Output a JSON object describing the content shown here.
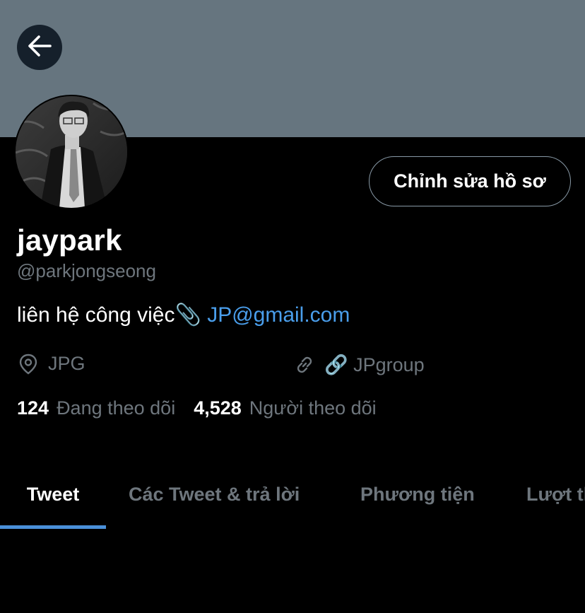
{
  "profile": {
    "display_name": "jaypark",
    "handle": "@parkjongseong",
    "bio_text": "liên hệ công việc📎",
    "bio_link": "JP@gmail.com",
    "location": "JPG",
    "website": "🔗 JPgroup",
    "following_count": "124",
    "following_label": "Đang theo dõi",
    "followers_count": "4,528",
    "followers_label": "Người theo dõi"
  },
  "buttons": {
    "edit_profile": "Chỉnh sửa hồ sơ"
  },
  "tabs": [
    {
      "label": "Tweet",
      "active": true
    },
    {
      "label": "Các Tweet & trả lời",
      "active": false
    },
    {
      "label": "Phương tiện",
      "active": false
    },
    {
      "label": "Lượt thích",
      "active": false
    }
  ],
  "colors": {
    "banner": "#66757f",
    "accent": "#4a90d9",
    "link": "#4a9eeb",
    "muted": "#6e767d"
  },
  "icons": {
    "back": "arrow-left-icon",
    "location": "location-pin-icon",
    "website": "link-icon"
  }
}
